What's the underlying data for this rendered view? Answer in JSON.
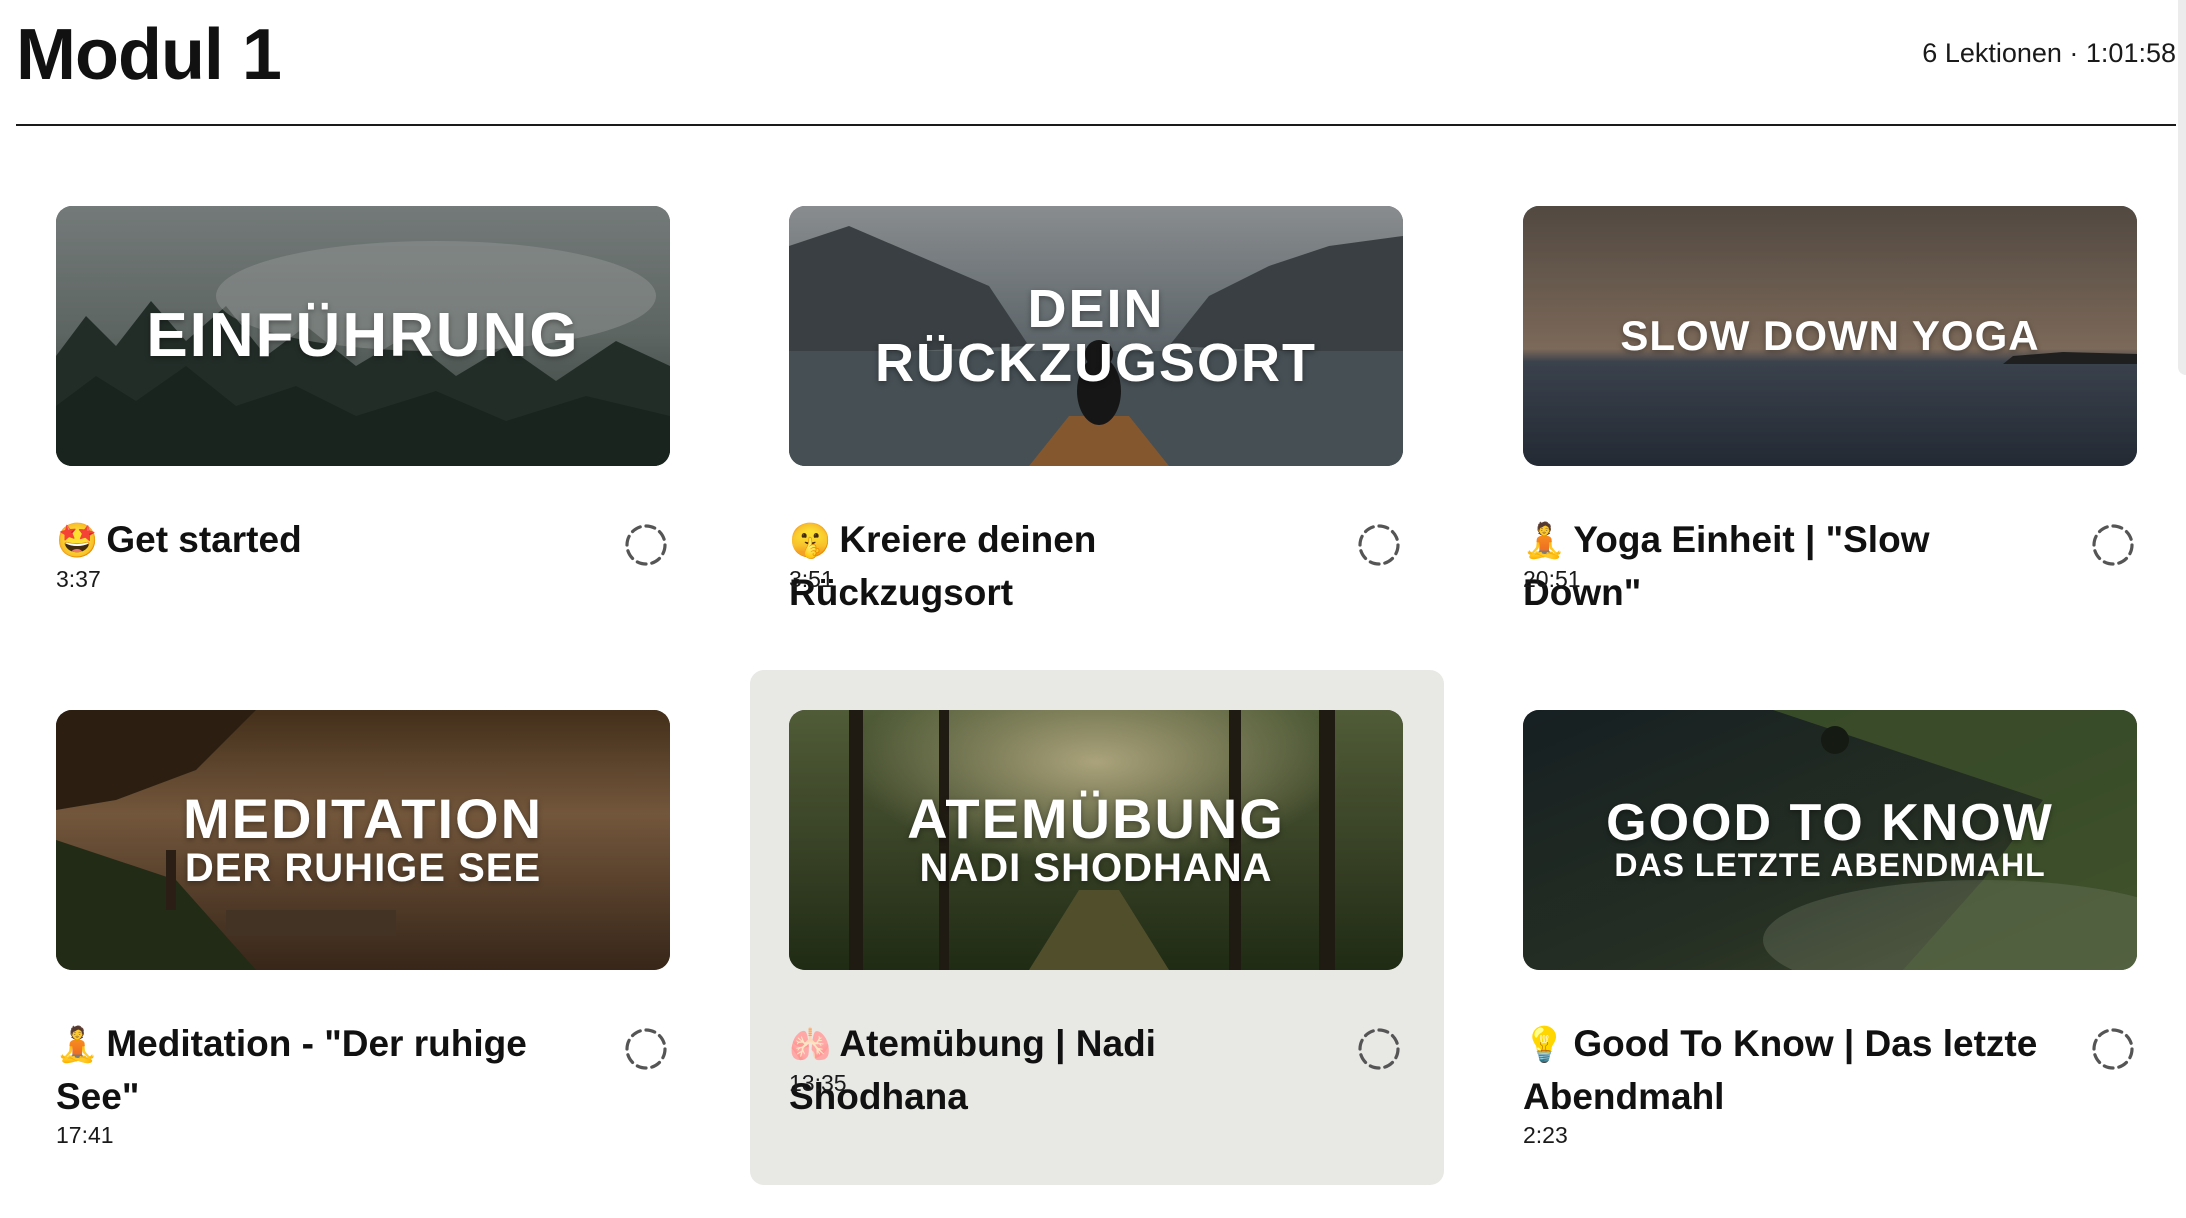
{
  "module": {
    "title": "Modul 1",
    "summary": "6 Lektionen · 1:01:58"
  },
  "lessons": [
    {
      "emoji": "🤩",
      "title": "Get started",
      "duration": "3:37",
      "thumbnail": {
        "main": "EINFÜHRUNG",
        "sub": ""
      },
      "status_icon": "incomplete-circle-icon"
    },
    {
      "emoji": "🤫",
      "title": "Kreiere deinen Rückzugsort",
      "duration": "3:51",
      "thumbnail": {
        "main": "DEIN",
        "sub": "RÜCKZUGSORT"
      },
      "status_icon": "incomplete-circle-icon"
    },
    {
      "emoji": "🧘",
      "title": "Yoga Einheit | \"Slow Down\"",
      "duration": "20:51",
      "thumbnail": {
        "main": "SLOW DOWN YOGA",
        "sub": ""
      },
      "status_icon": "incomplete-circle-icon"
    },
    {
      "emoji": "🧘",
      "title": "Meditation - \"Der ruhige See\"",
      "duration": "17:41",
      "thumbnail": {
        "main": "MEDITATION",
        "sub": "DER RUHIGE SEE"
      },
      "status_icon": "incomplete-circle-icon"
    },
    {
      "emoji": "🫁",
      "title": "Atemübung | Nadi Shodhana",
      "duration": "13:35",
      "thumbnail": {
        "main": "ATEMÜBUNG",
        "sub": "NADI SHODHANA"
      },
      "status_icon": "incomplete-circle-icon",
      "highlighted": true
    },
    {
      "emoji": "💡",
      "title": "Good To Know | Das letzte Abendmahl",
      "duration": "2:23",
      "thumbnail": {
        "main": "GOOD TO KNOW",
        "sub": "DAS LETZTE ABENDMAHL"
      },
      "status_icon": "incomplete-circle-icon"
    }
  ],
  "colors": {
    "highlight_card": "#e8e8e5",
    "divider": "#1a1a1a",
    "status_ring": "#555555"
  }
}
